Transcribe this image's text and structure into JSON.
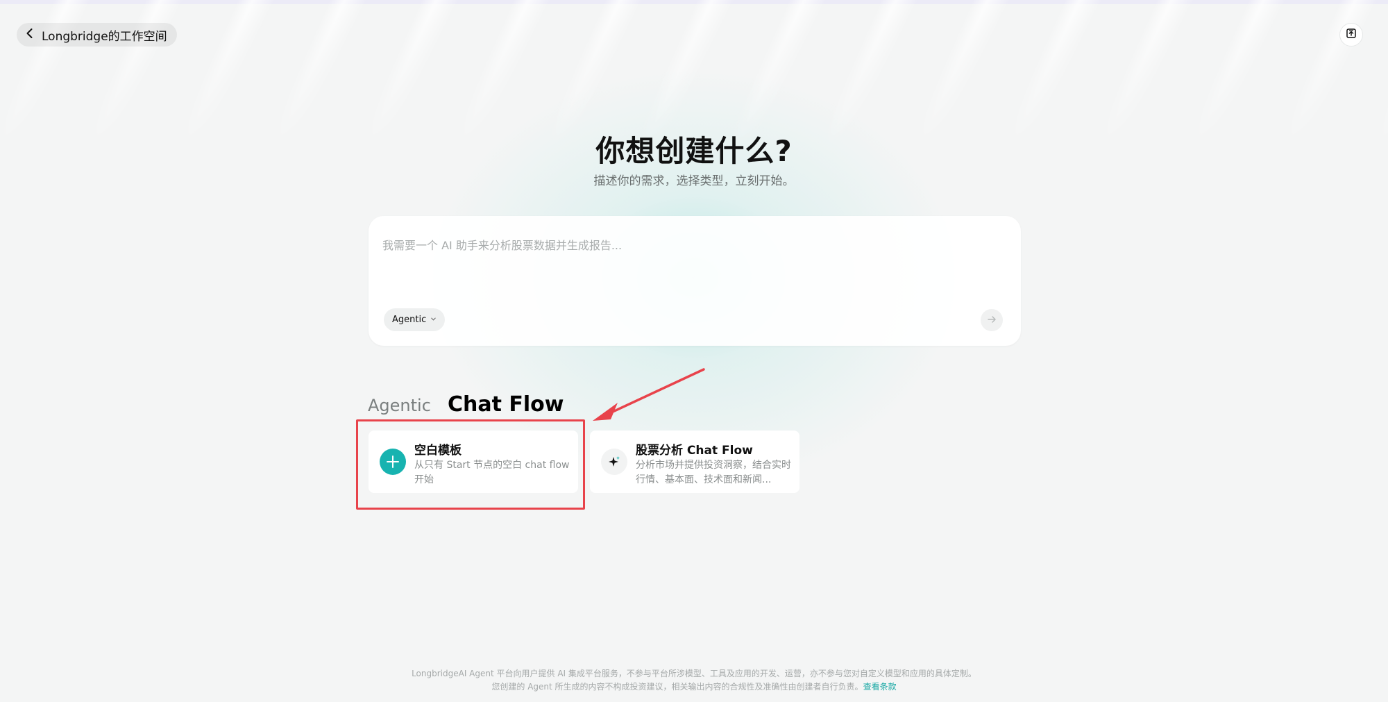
{
  "header": {
    "back_label": "Longbridge的工作空间"
  },
  "hero": {
    "title": "你想创建什么?",
    "subtitle": "描述你的需求，选择类型，立刻开始。"
  },
  "prompt": {
    "placeholder": "我需要一个 AI 助手来分析股票数据并生成报告...",
    "value": "",
    "mode_label": "Agentic"
  },
  "tabs": {
    "agentic": "Agentic",
    "chatflow": "Chat Flow"
  },
  "cards": [
    {
      "title": "空白模板",
      "description": "从只有 Start 节点的空白 chat flow 开始",
      "icon": "plus-icon"
    },
    {
      "title": "股票分析 Chat Flow",
      "description": "分析市场并提供投资洞察，结合实时行情、基本面、技术面和新闻...",
      "icon": "sparkle-icon"
    }
  ],
  "footer": {
    "line1": "LongbridgeAI Agent 平台向用户提供 AI 集成平台服务，不参与平台所涉模型、工具及应用的开发、运营，亦不参与您对自定义模型和应用的具体定制。",
    "line2": "您创建的 Agent 所生成的内容不构成投资建议，相关输出内容的合规性及准确性由创建者自行负责。",
    "terms_link": "查看条款"
  },
  "colors": {
    "accent": "#17b3b0",
    "annotation": "#e8434b",
    "link": "#17a8a4"
  }
}
